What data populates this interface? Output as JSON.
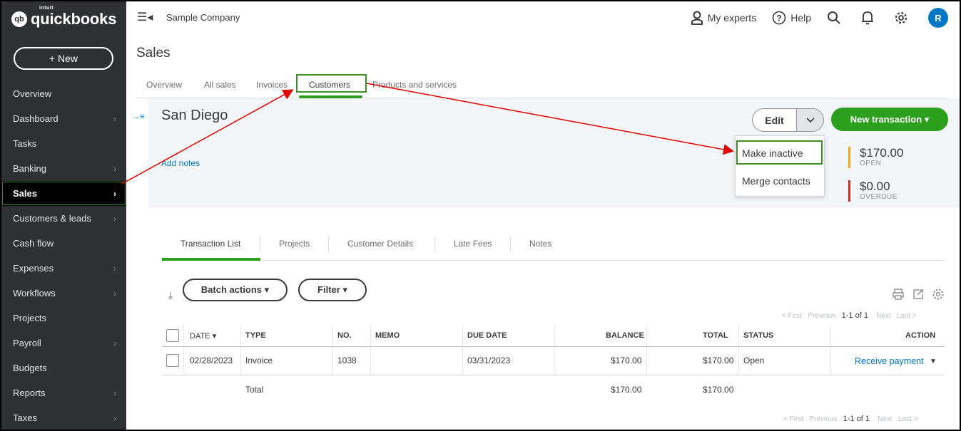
{
  "sidebar": {
    "logo_brand": "intuit",
    "logo_name": "quickbooks",
    "new_label": "+ New",
    "items": [
      {
        "label": "Overview",
        "chevron": false
      },
      {
        "label": "Dashboard",
        "chevron": true
      },
      {
        "label": "Tasks",
        "chevron": false
      },
      {
        "label": "Banking",
        "chevron": true
      },
      {
        "label": "Sales",
        "chevron": true
      },
      {
        "label": "Customers & leads",
        "chevron": true
      },
      {
        "label": "Cash flow",
        "chevron": false
      },
      {
        "label": "Expenses",
        "chevron": true
      },
      {
        "label": "Workflows",
        "chevron": true
      },
      {
        "label": "Projects",
        "chevron": false
      },
      {
        "label": "Payroll",
        "chevron": true
      },
      {
        "label": "Budgets",
        "chevron": false
      },
      {
        "label": "Reports",
        "chevron": true
      },
      {
        "label": "Taxes",
        "chevron": true
      }
    ]
  },
  "header": {
    "company": "Sample Company",
    "my_experts": "My experts",
    "help": "Help",
    "avatar_initial": "R"
  },
  "page": {
    "title": "Sales",
    "tabs": [
      "Overview",
      "All sales",
      "Invoices",
      "Customers",
      "Products and services"
    ]
  },
  "customer": {
    "name": "San Diego",
    "add_notes": "Add notes",
    "edit_label": "Edit",
    "new_transaction": "New transaction ▾",
    "menu": [
      "Make inactive",
      "Merge contacts"
    ],
    "open_amount": "$170.00",
    "open_label": "OPEN",
    "overdue_amount": "$0.00",
    "overdue_label": "OVERDUE"
  },
  "subtabs": [
    "Transaction List",
    "Projects",
    "Customer Details",
    "Late Fees",
    "Notes"
  ],
  "toolbar": {
    "batch_actions": "Batch actions ▾",
    "filter": "Filter ▾"
  },
  "pager": {
    "first": "< First",
    "previous": "Previous",
    "range": "1-1 of 1",
    "next": "Next",
    "last": "Last >"
  },
  "table": {
    "headers": {
      "date": "DATE ▾",
      "type": "TYPE",
      "no": "NO.",
      "memo": "MEMO",
      "due_date": "DUE DATE",
      "balance": "BALANCE",
      "total": "TOTAL",
      "status": "STATUS",
      "action": "ACTION"
    },
    "row": {
      "date": "02/28/2023",
      "type": "Invoice",
      "no": "1038",
      "memo": "",
      "due_date": "03/31/2023",
      "balance": "$170.00",
      "total": "$170.00",
      "status": "Open",
      "action": "Receive payment"
    },
    "totals": {
      "label": "Total",
      "balance": "$170.00",
      "total": "$170.00"
    }
  },
  "colors": {
    "accent_green": "#2ca01c",
    "link_blue": "#0077c5",
    "sidebar_bg": "#2e3033",
    "open_bar": "#f2a81d",
    "overdue_bar": "#d52b1e",
    "annotation_red": "#e00000",
    "highlight_box": "#3e8f28"
  }
}
